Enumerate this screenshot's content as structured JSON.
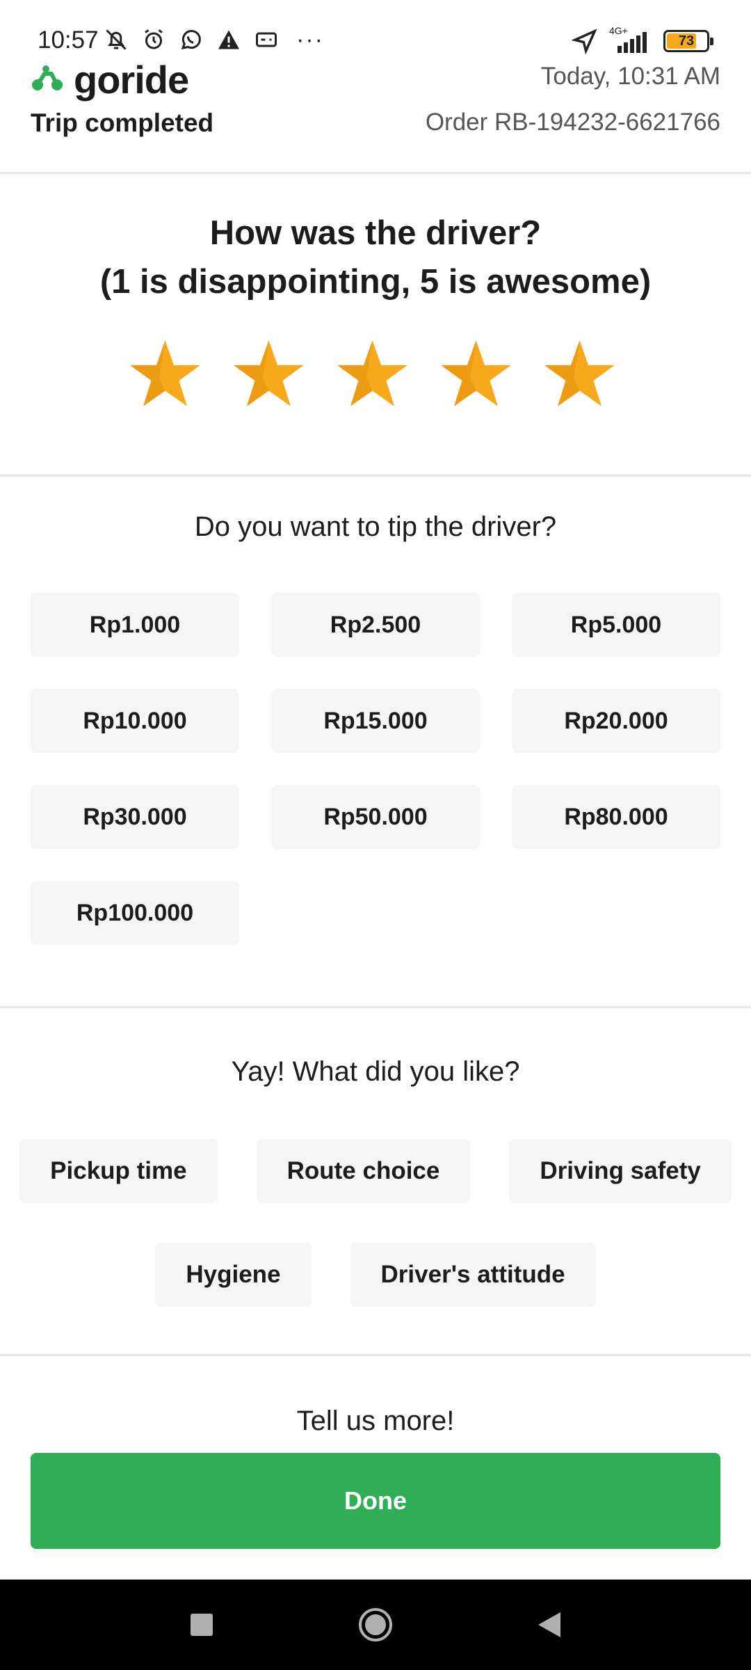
{
  "status_bar": {
    "time": "10:57",
    "network": "4G+",
    "battery": "73",
    "battery_level": 0.73,
    "icons": [
      "bell-off-icon",
      "alarm-icon",
      "whatsapp-icon",
      "warning-icon",
      "card-icon",
      "more-dots-icon",
      "location-arrow-icon",
      "signal-icon",
      "battery-icon"
    ]
  },
  "header": {
    "brand": "goride",
    "trip_status": "Trip completed",
    "date": "Today, 10:31 AM",
    "order": "Order RB-194232-6621766"
  },
  "rating": {
    "question_line1": "How was the driver?",
    "question_line2": "(1 is disappointing, 5 is awesome)",
    "stars_selected": 5,
    "stars_total": 5,
    "star_color": "#f7a81b"
  },
  "tips": {
    "question": "Do you want to tip the driver?",
    "options": [
      "Rp1.000",
      "Rp2.500",
      "Rp5.000",
      "Rp10.000",
      "Rp15.000",
      "Rp20.000",
      "Rp30.000",
      "Rp50.000",
      "Rp80.000",
      "Rp100.000"
    ]
  },
  "likes": {
    "question": "Yay! What did you like?",
    "row1": [
      "Pickup time",
      "Route choice",
      "Driving safety"
    ],
    "row2": [
      "Hygiene",
      "Driver's attitude"
    ]
  },
  "feedback": {
    "prompt": "Tell us more!"
  },
  "done_button": "Done",
  "colors": {
    "brand_green": "#2fae55",
    "chip_background": "#f4f5f7"
  },
  "nav": [
    "recent-apps-icon",
    "home-icon",
    "back-icon"
  ]
}
